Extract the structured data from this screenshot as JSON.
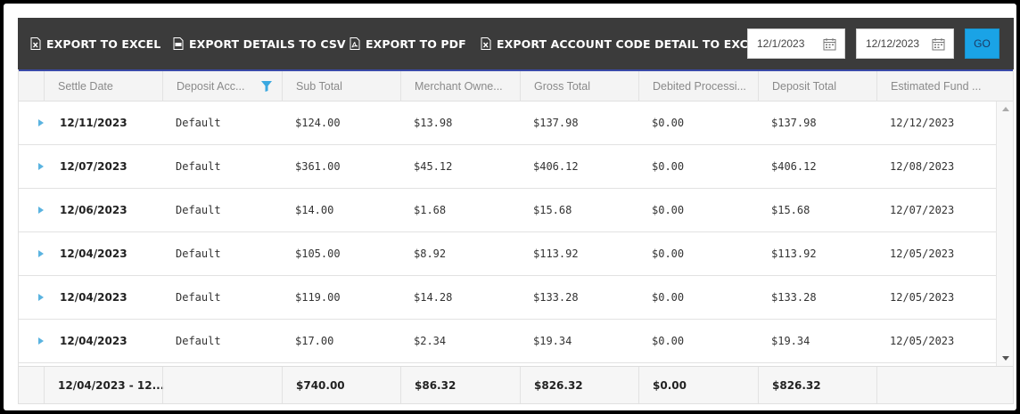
{
  "toolbar": {
    "export_excel": "EXPORT TO EXCEL",
    "export_csv": "EXPORT DETAILS TO CSV",
    "export_pdf": "EXPORT TO PDF",
    "export_account_code": "EXPORT ACCOUNT CODE DETAIL TO EXCEL",
    "start_date": "12/1/2023",
    "end_date": "12/12/2023",
    "go_label": "GO"
  },
  "grid": {
    "columns": [
      "Settle Date",
      "Deposit Acc...",
      "Sub Total",
      "Merchant Owne...",
      "Gross Total",
      "Debited Processi...",
      "Deposit Total",
      "Estimated Fund ..."
    ],
    "rows": [
      [
        "12/11/2023",
        "Default",
        "$124.00",
        "$13.98",
        "$137.98",
        "$0.00",
        "$137.98",
        "12/12/2023"
      ],
      [
        "12/07/2023",
        "Default",
        "$361.00",
        "$45.12",
        "$406.12",
        "$0.00",
        "$406.12",
        "12/08/2023"
      ],
      [
        "12/06/2023",
        "Default",
        "$14.00",
        "$1.68",
        "$15.68",
        "$0.00",
        "$15.68",
        "12/07/2023"
      ],
      [
        "12/04/2023",
        "Default",
        "$105.00",
        "$8.92",
        "$113.92",
        "$0.00",
        "$113.92",
        "12/05/2023"
      ],
      [
        "12/04/2023",
        "Default",
        "$119.00",
        "$14.28",
        "$133.28",
        "$0.00",
        "$133.28",
        "12/05/2023"
      ],
      [
        "12/04/2023",
        "Default",
        "$17.00",
        "$2.34",
        "$19.34",
        "$0.00",
        "$19.34",
        "12/05/2023"
      ]
    ],
    "footer": [
      "12/04/2023 - 12...",
      "",
      "$740.00",
      "$86.32",
      "$826.32",
      "$0.00",
      "$826.32",
      ""
    ]
  },
  "colors": {
    "toolbar_bg": "#3b3b3b",
    "go_button": "#1aa3e6",
    "expander": "#5ab3e0",
    "filter_icon": "#3aa8e0"
  },
  "icons": {
    "excel": "excel-file-icon",
    "csv": "csv-file-icon",
    "pdf": "pdf-file-icon",
    "calendar": "calendar-icon",
    "filter": "filter-icon"
  }
}
